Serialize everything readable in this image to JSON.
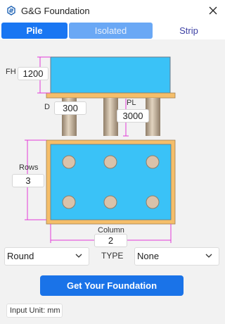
{
  "window": {
    "title": "G&G Foundation",
    "icon": "app-logo-icon",
    "close_icon": "close-icon"
  },
  "tabs": [
    {
      "label": "Pile",
      "state": "active"
    },
    {
      "label": "Isolated",
      "state": "disabled"
    },
    {
      "label": "Strip",
      "state": "inactive"
    }
  ],
  "dimensions": {
    "fh": {
      "label": "FH",
      "value": "1200"
    },
    "d": {
      "label": "D",
      "value": "300"
    },
    "pl": {
      "label": "PL",
      "value": "3000"
    },
    "rows": {
      "label": "Rows",
      "value": "3"
    },
    "column": {
      "label": "Column",
      "value": "2"
    }
  },
  "controls": {
    "shape_select": {
      "value": "Round",
      "icon": "chevron-down-icon"
    },
    "type_label": "TYPE",
    "type_select": {
      "value": "None",
      "icon": "chevron-down-icon"
    },
    "submit_label": "Get Your Foundation",
    "unit_note": "Input Unit: mm"
  },
  "colors": {
    "accent": "#1a73e8",
    "pile_cap_fill": "#3ac2f7",
    "pile_fill": "#c9b59b",
    "frame_fill": "#f5be6a",
    "dimension_line": "#e23ad8"
  }
}
